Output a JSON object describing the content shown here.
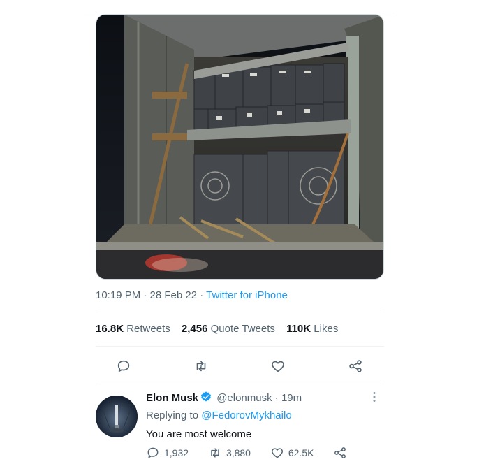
{
  "tweet": {
    "media": {
      "alt": ""
    },
    "timestamp": "10:19 PM · 28 Feb 22 · ",
    "source": "Twitter for iPhone",
    "stats": {
      "retweets_count": "16.8K",
      "retweets_label": "Retweets",
      "quotes_count": "2,456",
      "quotes_label": "Quote Tweets",
      "likes_count": "110K",
      "likes_label": "Likes"
    },
    "actions": {
      "reply_icon": "reply-icon",
      "retweet_icon": "retweet-icon",
      "like_icon": "heart-icon",
      "share_icon": "share-icon"
    }
  },
  "reply": {
    "author_name": "Elon Musk",
    "handle": "@elonmusk",
    "time": " · 19m",
    "replying_prefix": "Replying to ",
    "replying_to": "@FedorovMykhailo",
    "text": "You are most welcome",
    "reply_count": "1,932",
    "retweet_count": "3,880",
    "like_count": "62.5K",
    "verified_icon": "verified-badge-icon",
    "more_icon": "more-dots-icon"
  },
  "colors": {
    "link": "#1d9bf0",
    "secondary_text": "#536471",
    "primary_text": "#0f1419",
    "divider": "#eff3f4"
  }
}
